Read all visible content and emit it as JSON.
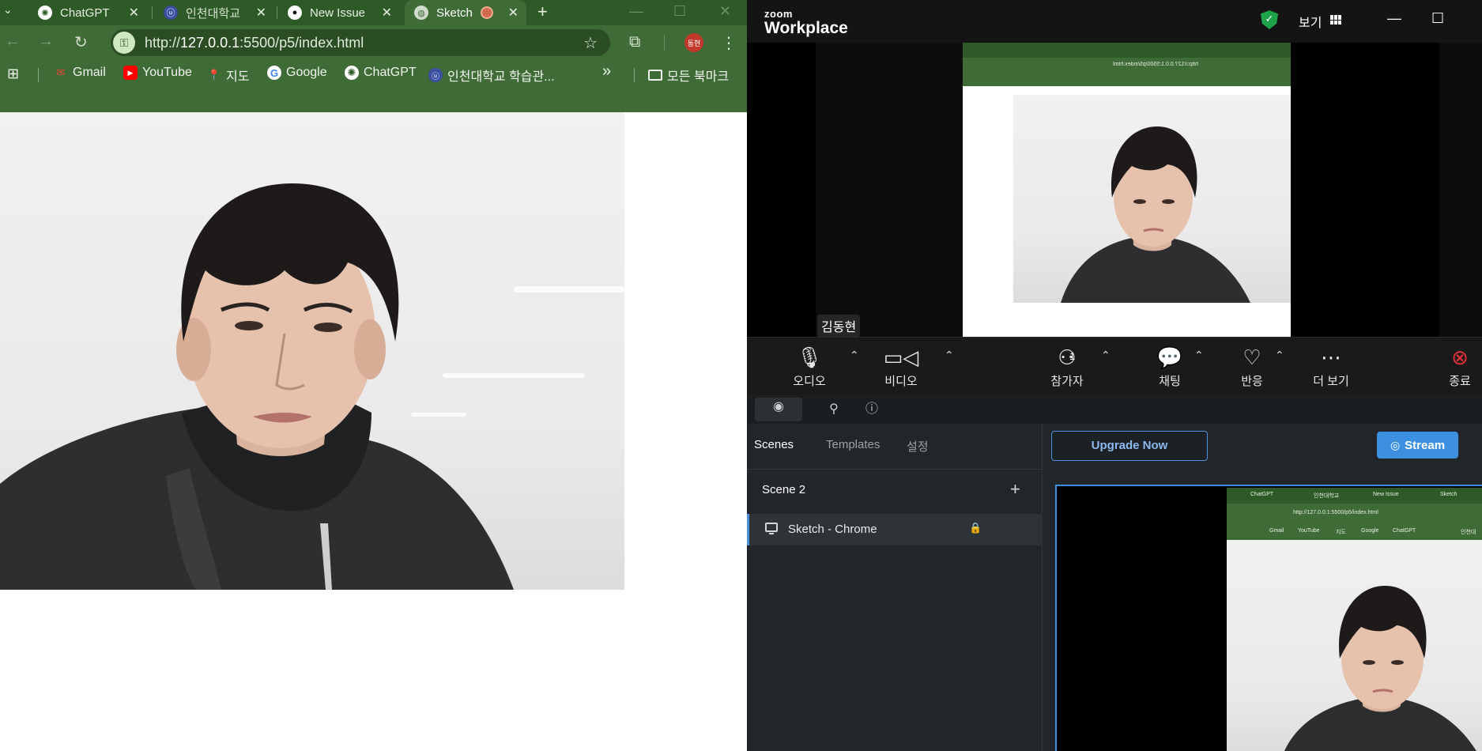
{
  "chrome": {
    "tabs": [
      {
        "title": "ChatGPT",
        "icon": "chatgpt-icon",
        "active": false
      },
      {
        "title": "인천대학교",
        "icon": "university-icon",
        "active": false
      },
      {
        "title": "New Issue",
        "icon": "github-icon",
        "active": false
      },
      {
        "title": "Sketch",
        "icon": "globe-icon",
        "active": true
      }
    ],
    "new_tab_label": "+",
    "url_prefix": "http://",
    "url_host": "127.0.0.1",
    "url_path": ":5500/p5/index.html",
    "profile_label": "동현",
    "bookmarks": [
      {
        "label": "Gmail",
        "icon": "gmail-icon"
      },
      {
        "label": "YouTube",
        "icon": "youtube-icon"
      },
      {
        "label": "지도",
        "icon": "maps-icon"
      },
      {
        "label": "Google",
        "icon": "google-icon"
      },
      {
        "label": "ChatGPT",
        "icon": "chatgpt-icon"
      },
      {
        "label": "인천대학교 학습관...",
        "icon": "university-icon"
      }
    ],
    "bookmarks_overflow": "»",
    "all_bookmarks_label": "모든 북마크",
    "colors": {
      "frame": "#2d5a27",
      "toolbar": "#3e6b36"
    }
  },
  "zoom": {
    "logo_small": "zoom",
    "logo_big": "Workplace",
    "view_label": "보기",
    "participant_name": "김동현",
    "participant_count": "1",
    "controls": [
      {
        "label": "오디오",
        "icon": "microphone-icon"
      },
      {
        "label": "비디오",
        "icon": "video-camera-icon"
      },
      {
        "label": "참가자",
        "icon": "participants-icon"
      },
      {
        "label": "채팅",
        "icon": "chat-icon"
      },
      {
        "label": "반응",
        "icon": "heart-icon"
      },
      {
        "label": "더 보기",
        "icon": "more-icon"
      },
      {
        "label": "종료",
        "icon": "end-icon"
      }
    ],
    "mini_url": "http://127.0.0.1:5500/p5/index.html"
  },
  "stream": {
    "tabs": [
      {
        "label": "Scenes",
        "active": true
      },
      {
        "label": "Templates",
        "active": false
      },
      {
        "label": "설정",
        "active": false
      }
    ],
    "scene_name": "Scene 2",
    "source_name": "Sketch - Chrome",
    "upgrade_label": "Upgrade Now",
    "stream_label": "Stream",
    "mini_tabs": [
      "ChatGPT",
      "인천대학교",
      "New Issue",
      "Sketch"
    ],
    "mini_url": "http://127.0.0.1:5500/p5/index.html",
    "mini_bookmarks": [
      "Gmail",
      "YouTube",
      "지도",
      "Google",
      "ChatGPT",
      "인천대"
    ]
  }
}
